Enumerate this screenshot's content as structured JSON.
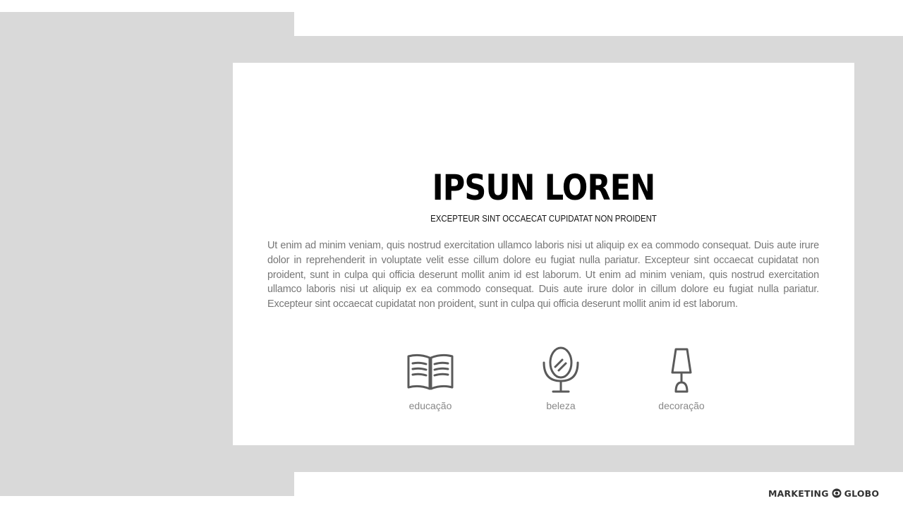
{
  "slide": {
    "title": "IPSUN LOREN",
    "subtitle": "EXCEPTEUR SINT OCCAECAT CUPIDATAT NON PROIDENT",
    "body": "Ut enim ad minim veniam, quis nostrud exercitation ullamco laboris nisi ut aliquip ex ea commodo consequat. Duis aute irure dolor in reprehenderit in voluptate velit esse cillum dolore eu fugiat nulla pariatur. Excepteur sint occaecat cupidatat non proident, sunt in culpa qui officia deserunt mollit anim id est laborum. Ut enim ad minim veniam, quis nostrud exercitation ullamco laboris nisi ut aliquip ex ea commodo consequat. Duis aute irure dolor in cillum dolore eu fugiat nulla pariatur. Excepteur sint occaecat cupidatat non proident, sunt in culpa qui officia deserunt mollit anim id est laborum.",
    "categories": [
      {
        "label": "educação",
        "icon": "book-icon"
      },
      {
        "label": "beleza",
        "icon": "mirror-icon"
      },
      {
        "label": "decoração",
        "icon": "lamp-icon"
      }
    ]
  },
  "brand": {
    "left": "MARKETING",
    "right": "GLOBO",
    "icon": "globo-logo-icon"
  },
  "colors": {
    "background_gray": "#d9d9d9",
    "card": "#ffffff",
    "icon_stroke": "#5a5a5a",
    "body_text": "#777777"
  }
}
